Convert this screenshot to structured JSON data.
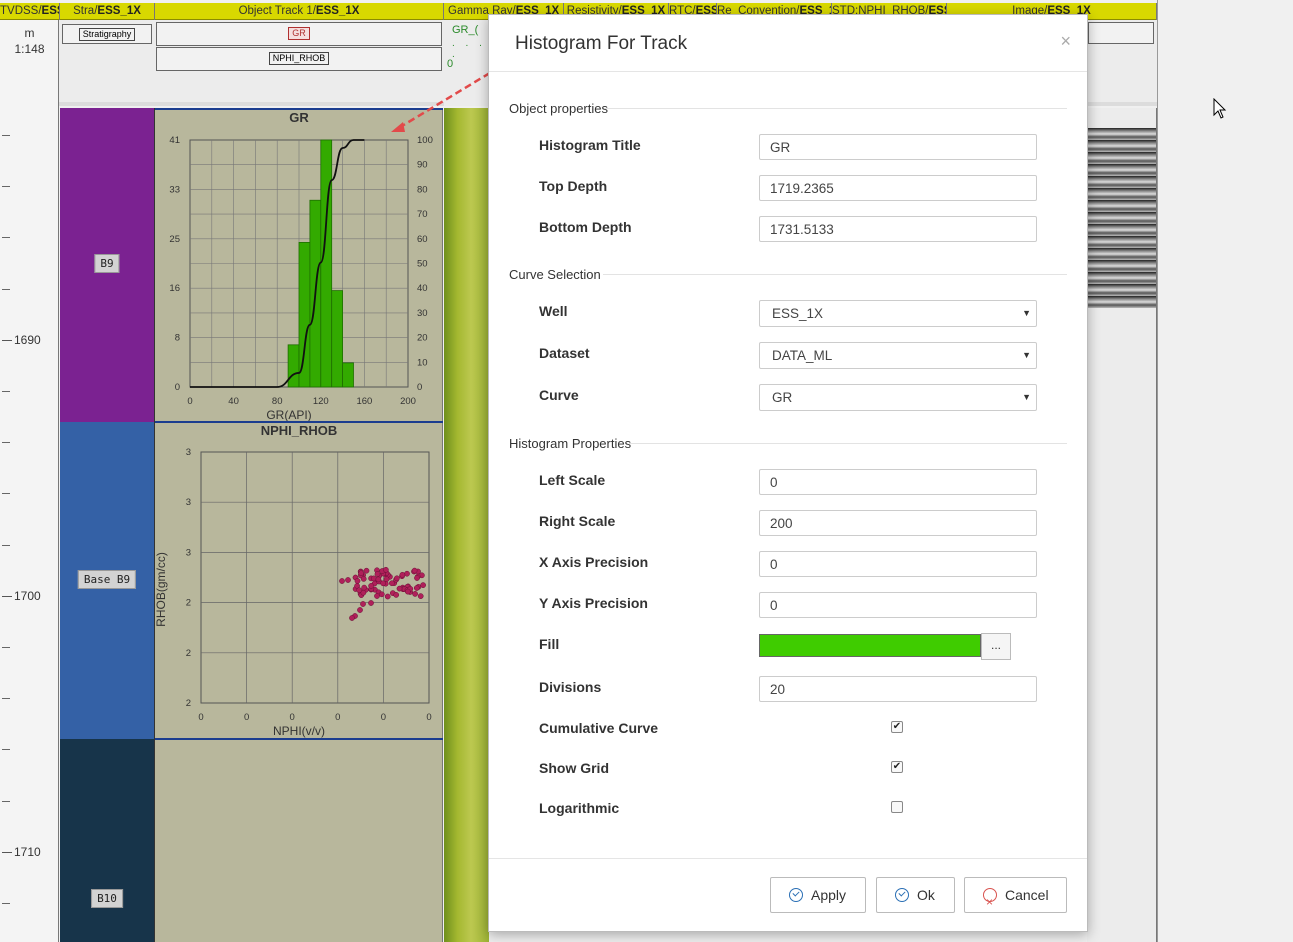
{
  "track_headers": [
    {
      "prefix": "TVDSS/",
      "bold": "ESS"
    },
    {
      "prefix": "Stra/",
      "bold": "ESS_1X"
    },
    {
      "prefix": "Object Track 1/",
      "bold": "ESS_1X"
    },
    {
      "prefix": "Gamma Ray/",
      "bold": "ESS_1X"
    },
    {
      "prefix": "Resistivity/",
      "bold": "ESS_1X"
    },
    {
      "prefix": "RTC/",
      "bold": "ESS"
    },
    {
      "prefix": "Re_Convention/",
      "bold": "ESS_1"
    },
    {
      "prefix": "STD:NPHI_RHOB/",
      "bold": "ESS"
    },
    {
      "prefix": "Image/",
      "bold": "ESS_1X"
    }
  ],
  "depth_header": {
    "unit": "m",
    "scale": "1:148"
  },
  "stratigraphy_chip": "Stratigraphy",
  "object_chips": [
    "GR",
    "NPHI_RHOB"
  ],
  "gr_header_fragment": "GR_(",
  "gr_header_zero": "0",
  "depth_labels": [
    "1690",
    "1700",
    "1710"
  ],
  "zones": [
    {
      "name": "B9",
      "color": "#7b2291"
    },
    {
      "name": "Base B9",
      "color": "#3461a6"
    },
    {
      "name": "B10",
      "color": "#17344a"
    }
  ],
  "histogram_chart": {
    "chart_data": {
      "type": "bar",
      "title": "GR",
      "xlabel": "GR(API)",
      "x_ticks": [
        "0",
        "40",
        "80",
        "120",
        "160",
        "200"
      ],
      "y_ticks_left": [
        "0",
        "8",
        "16",
        "25",
        "33",
        "41"
      ],
      "y_ticks_right": [
        "0",
        "10",
        "20",
        "30",
        "40",
        "50",
        "60",
        "70",
        "80",
        "90",
        "100"
      ],
      "xlim": [
        0,
        200
      ],
      "ylim": [
        0,
        41
      ],
      "bin_width": 10,
      "bins": [
        {
          "x": 90,
          "value": 7
        },
        {
          "x": 100,
          "value": 24
        },
        {
          "x": 110,
          "value": 31
        },
        {
          "x": 120,
          "value": 41
        },
        {
          "x": 130,
          "value": 16
        },
        {
          "x": 140,
          "value": 4
        }
      ],
      "cumulative_curve": true,
      "fill": "#33aa00",
      "grid": true
    }
  },
  "crossplot_chart": {
    "chart_data": {
      "type": "scatter",
      "title": "NPHI_RHOB",
      "xlabel": "NPHI(v/v)",
      "ylabel": "RHOB(gm/cc)",
      "x_ticks": [
        "0",
        "0",
        "0",
        "0",
        "0",
        "0"
      ],
      "y_ticks": [
        "2",
        "2",
        "2",
        "3",
        "3",
        "3"
      ],
      "point_color": "#b0205a",
      "grid": true,
      "note": "points cluster in the lower-right; axis tick labels shown rounded to 0 precision"
    }
  },
  "modal": {
    "title": "Histogram For Track",
    "close_glyph": "×",
    "sections": {
      "object_properties": "Object properties",
      "curve_selection": "Curve Selection",
      "histogram_properties": "Histogram Properties"
    },
    "fields": {
      "histogram_title": {
        "label": "Histogram Title",
        "value": "GR"
      },
      "top_depth": {
        "label": "Top Depth",
        "value": "1719.2365"
      },
      "bottom_depth": {
        "label": "Bottom Depth",
        "value": "1731.5133"
      },
      "well": {
        "label": "Well",
        "value": "ESS_1X"
      },
      "dataset": {
        "label": "Dataset",
        "value": "DATA_ML"
      },
      "curve": {
        "label": "Curve",
        "value": "GR"
      },
      "left_scale": {
        "label": "Left Scale",
        "value": "0"
      },
      "right_scale": {
        "label": "Right Scale",
        "value": "200"
      },
      "x_precision": {
        "label": "X Axis Precision",
        "value": "0"
      },
      "y_precision": {
        "label": "Y Axis Precision",
        "value": "0"
      },
      "fill": {
        "label": "Fill",
        "color": "#3fcc00",
        "button": "..."
      },
      "divisions": {
        "label": "Divisions",
        "value": "20"
      },
      "cumulative": {
        "label": "Cumulative Curve",
        "checked": true
      },
      "show_grid": {
        "label": "Show Grid",
        "checked": true
      },
      "logarithmic": {
        "label": "Logarithmic",
        "checked": false
      }
    },
    "buttons": {
      "apply": "Apply",
      "ok": "Ok",
      "cancel": "Cancel"
    }
  }
}
